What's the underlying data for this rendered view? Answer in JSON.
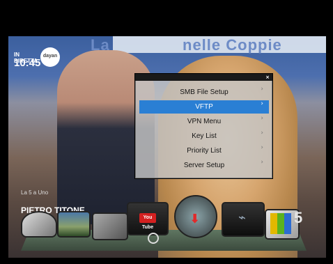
{
  "overlay": {
    "banner_left": "La",
    "banner_right": "nelle Coppie",
    "clock_label": "IN DIRETTA",
    "clock_time": "10:45",
    "channel_logo": "dayan",
    "show_caption": "La 5 a Uno",
    "presenter_name": "PIETRO TITONE",
    "network_logo": "5"
  },
  "menu": {
    "close_glyph": "×",
    "items": [
      {
        "label": "SMB File Setup",
        "selected": false
      },
      {
        "label": "VFTP",
        "selected": true
      },
      {
        "label": "VPN Menu",
        "selected": false
      },
      {
        "label": "Key List",
        "selected": false
      },
      {
        "label": "Priority List",
        "selected": false
      },
      {
        "label": "Server Setup",
        "selected": false
      }
    ],
    "chevron": "›",
    "selected_color": "#2a7fd4"
  },
  "dock": {
    "items": [
      {
        "icon": "satellite-icon"
      },
      {
        "icon": "picture-icon"
      },
      {
        "icon": "settings-icon"
      },
      {
        "icon": "youtube-icon",
        "label": "You Tube"
      },
      {
        "icon": "www-download-icon",
        "glyph": "⬇"
      },
      {
        "icon": "usb-icon",
        "glyph": "⌁"
      },
      {
        "icon": "games-icon"
      }
    ]
  }
}
